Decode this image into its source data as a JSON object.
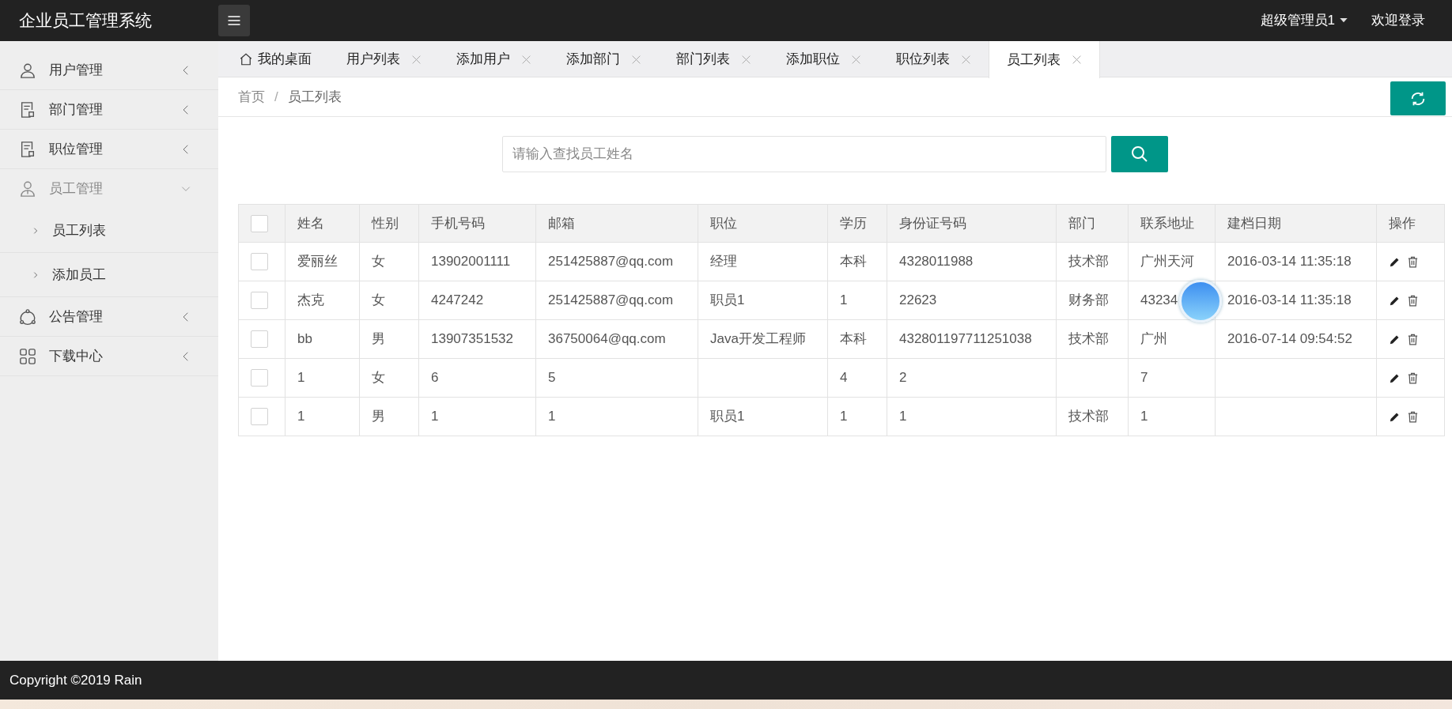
{
  "header": {
    "title": "企业员工管理系统",
    "user": "超级管理员1",
    "welcome": "欢迎登录"
  },
  "sidebar": {
    "items": [
      {
        "label": "用户管理",
        "kind": "user",
        "expanded": false
      },
      {
        "label": "部门管理",
        "kind": "doc",
        "expanded": false
      },
      {
        "label": "职位管理",
        "kind": "doc",
        "expanded": false
      },
      {
        "label": "员工管理",
        "kind": "staff",
        "expanded": true,
        "children": [
          {
            "label": "员工列表"
          },
          {
            "label": "添加员工"
          }
        ]
      },
      {
        "label": "公告管理",
        "kind": "share",
        "expanded": false
      },
      {
        "label": "下载中心",
        "kind": "grid",
        "expanded": false
      }
    ]
  },
  "tabs": [
    {
      "label": "我的桌面",
      "kind": "home",
      "selected": false
    },
    {
      "label": "用户列表",
      "kind": "closable",
      "selected": false
    },
    {
      "label": "添加用户",
      "kind": "closable",
      "selected": false
    },
    {
      "label": "添加部门",
      "kind": "closable",
      "selected": false
    },
    {
      "label": "部门列表",
      "kind": "closable",
      "selected": false
    },
    {
      "label": "添加职位",
      "kind": "closable",
      "selected": false
    },
    {
      "label": "职位列表",
      "kind": "closable",
      "selected": false
    },
    {
      "label": "员工列表",
      "kind": "closable",
      "selected": true
    }
  ],
  "breadcrumb": {
    "items": [
      "首页",
      "员工列表"
    ],
    "separator": "/"
  },
  "search": {
    "placeholder": "请输入查找员工姓名"
  },
  "table": {
    "select_all": {
      "checked": false
    },
    "columns": [
      "姓名",
      "性别",
      "手机号码",
      "邮箱",
      "职位",
      "学历",
      "身份证号码",
      "部门",
      "联系地址",
      "建档日期",
      "操作"
    ],
    "rows": [
      {
        "checked": false,
        "cells": [
          "爱丽丝",
          "女",
          "13902001111",
          "251425887@qq.com",
          "经理",
          "本科",
          "4328011988",
          "技术部",
          "广州天河",
          "2016-03-14 11:35:18"
        ]
      },
      {
        "checked": false,
        "cells": [
          "杰克",
          "女",
          "4247242",
          "251425887@qq.com",
          "职员1",
          "1",
          "22623",
          "财务部",
          "43234",
          "2016-03-14 11:35:18"
        ]
      },
      {
        "checked": false,
        "cells": [
          "bb",
          "男",
          "13907351532",
          "36750064@qq.com",
          "Java开发工程师",
          "本科",
          "432801197711251038",
          "技术部",
          "广州",
          "2016-07-14 09:54:52"
        ]
      },
      {
        "checked": false,
        "cells": [
          "1",
          "女",
          "6",
          "5",
          "",
          "4",
          "2",
          "",
          "7",
          ""
        ]
      },
      {
        "checked": false,
        "cells": [
          "1",
          "男",
          "1",
          "1",
          "职员1",
          "1",
          "1",
          "技术部",
          "1",
          ""
        ]
      }
    ]
  },
  "footer": {
    "copyright": "Copyright ©2019 Rain"
  }
}
